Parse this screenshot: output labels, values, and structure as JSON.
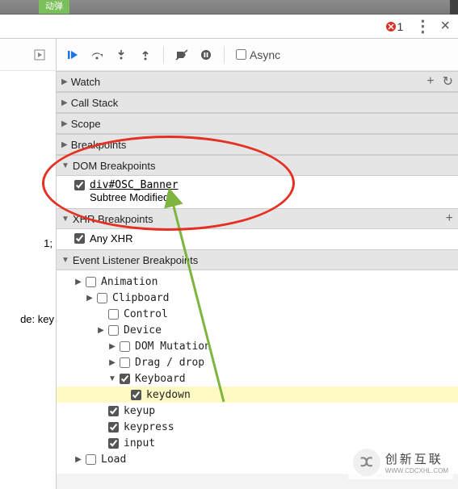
{
  "top_tab": "动弹",
  "header": {
    "error_count": "1"
  },
  "toolbar": {
    "async_label": "Async"
  },
  "gutter": {
    "line1": "1;",
    "line2": "de: key"
  },
  "sections": {
    "watch": "Watch",
    "callstack": "Call Stack",
    "scope": "Scope",
    "breakpoints": "Breakpoints",
    "dom_breakpoints": "DOM Breakpoints",
    "xhr_breakpoints": "XHR Breakpoints",
    "event_listener_breakpoints": "Event Listener Breakpoints"
  },
  "dom_bp": {
    "selector": "div#OSC_Banner",
    "type": "Subtree Modified",
    "checked": true
  },
  "xhr": {
    "any_label": "Any XHR",
    "checked": true
  },
  "event_tree": [
    {
      "indent": 1,
      "arrow": "▶",
      "checked": false,
      "label": "Animation"
    },
    {
      "indent": 2,
      "arrow": "▶",
      "checked": false,
      "label": "Clipboard"
    },
    {
      "indent": 3,
      "arrow": "",
      "checked": false,
      "label": "Control"
    },
    {
      "indent": 3,
      "arrow": "▶",
      "checked": false,
      "label": "Device"
    },
    {
      "indent": 4,
      "arrow": "▶",
      "checked": false,
      "label": "DOM Mutation"
    },
    {
      "indent": 4,
      "arrow": "▶",
      "checked": false,
      "label": "Drag / drop"
    },
    {
      "indent": 4,
      "arrow": "▼",
      "checked": true,
      "label": "Keyboard"
    },
    {
      "indent": 5,
      "arrow": "",
      "checked": true,
      "label": "keydown",
      "hl": true
    },
    {
      "indent": 3,
      "arrow": "",
      "checked": true,
      "label": "keyup"
    },
    {
      "indent": 3,
      "arrow": "",
      "checked": true,
      "label": "keypress"
    },
    {
      "indent": 3,
      "arrow": "",
      "checked": true,
      "label": "input"
    },
    {
      "indent": 1,
      "arrow": "▶",
      "checked": false,
      "label": "Load"
    }
  ],
  "watermark": {
    "brand": "创新互联",
    "sub": "WWW.CDCXHL.COM"
  }
}
